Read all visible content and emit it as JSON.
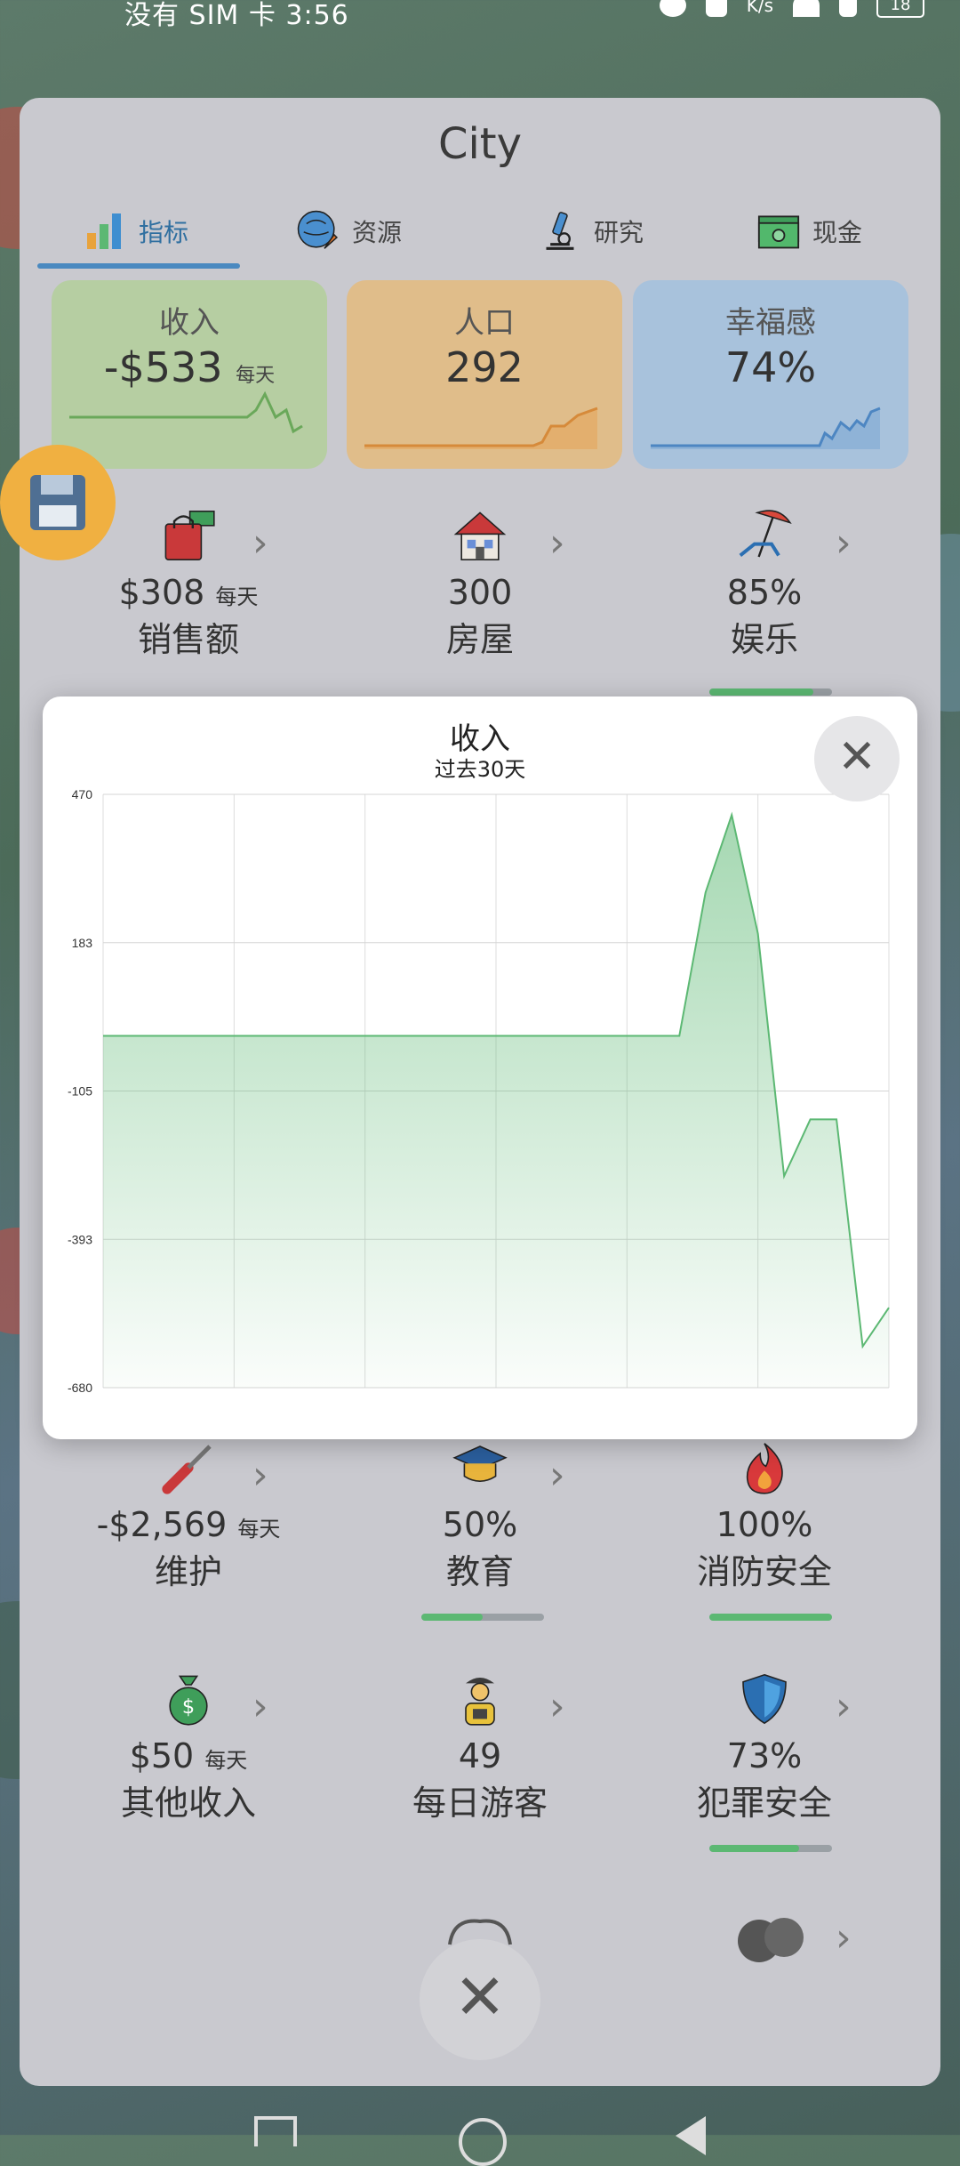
{
  "status_bar": {
    "left_text": "没有 SIM 卡 3:56",
    "speed_unit": "K/s",
    "battery": "18"
  },
  "panel": {
    "title": "City",
    "tabs": [
      {
        "label": "指标",
        "icon": "bar-chart-icon",
        "active": true
      },
      {
        "label": "资源",
        "icon": "globe-carrot-icon",
        "active": false
      },
      {
        "label": "研究",
        "icon": "microscope-icon",
        "active": false
      },
      {
        "label": "现金",
        "icon": "cash-icon",
        "active": false
      }
    ],
    "stat_cards": [
      {
        "label": "收入",
        "value": "-$533",
        "per": "每天",
        "color": "#b8d1a3"
      },
      {
        "label": "人口",
        "value": "292",
        "per": "",
        "color": "#e2c08e"
      },
      {
        "label": "幸福感",
        "value": "74%",
        "per": "",
        "color": "#a9c3dc"
      }
    ],
    "items_row1": [
      {
        "value": "$308",
        "per": "每天",
        "name": "销售额",
        "icon": "shopping-bag-icon"
      },
      {
        "value": "300",
        "per": "",
        "name": "房屋",
        "icon": "house-icon"
      },
      {
        "value": "85%",
        "per": "",
        "name": "娱乐",
        "icon": "beach-chair-icon",
        "progress": 0.85
      }
    ],
    "items_row2": [
      {
        "value": "-$2,569",
        "per": "每天",
        "name": "维护",
        "icon": "screwdriver-icon"
      },
      {
        "value": "50%",
        "per": "",
        "name": "教育",
        "icon": "graduation-cap-icon",
        "progress": 0.5
      },
      {
        "value": "100%",
        "per": "",
        "name": "消防安全",
        "icon": "fire-icon",
        "progress": 1.0
      }
    ],
    "items_row3": [
      {
        "value": "$50",
        "per": "每天",
        "name": "其他收入",
        "icon": "money-bag-icon"
      },
      {
        "value": "49",
        "per": "",
        "name": "每日游客",
        "icon": "tourist-icon"
      },
      {
        "value": "73%",
        "per": "",
        "name": "犯罪安全",
        "icon": "shield-icon",
        "progress": 0.73
      }
    ],
    "close_symbol": "✕"
  },
  "modal": {
    "title": "收入",
    "subtitle": "过去30天",
    "close_symbol": "✕"
  },
  "chart_data": {
    "type": "area",
    "title": "收入",
    "subtitle": "过去30天",
    "xlabel": "",
    "ylabel": "",
    "yticks": [
      "470",
      "183",
      "-105",
      "-393",
      "-680"
    ],
    "ylim": [
      -680,
      470
    ],
    "xlim": [
      0,
      30
    ],
    "grid": true,
    "color": "#5cb873",
    "x": [
      0,
      22,
      23,
      24,
      25,
      26,
      27,
      28,
      29,
      30
    ],
    "values": [
      2,
      2,
      280,
      430,
      200,
      -270,
      -160,
      -160,
      -600,
      -525
    ]
  }
}
